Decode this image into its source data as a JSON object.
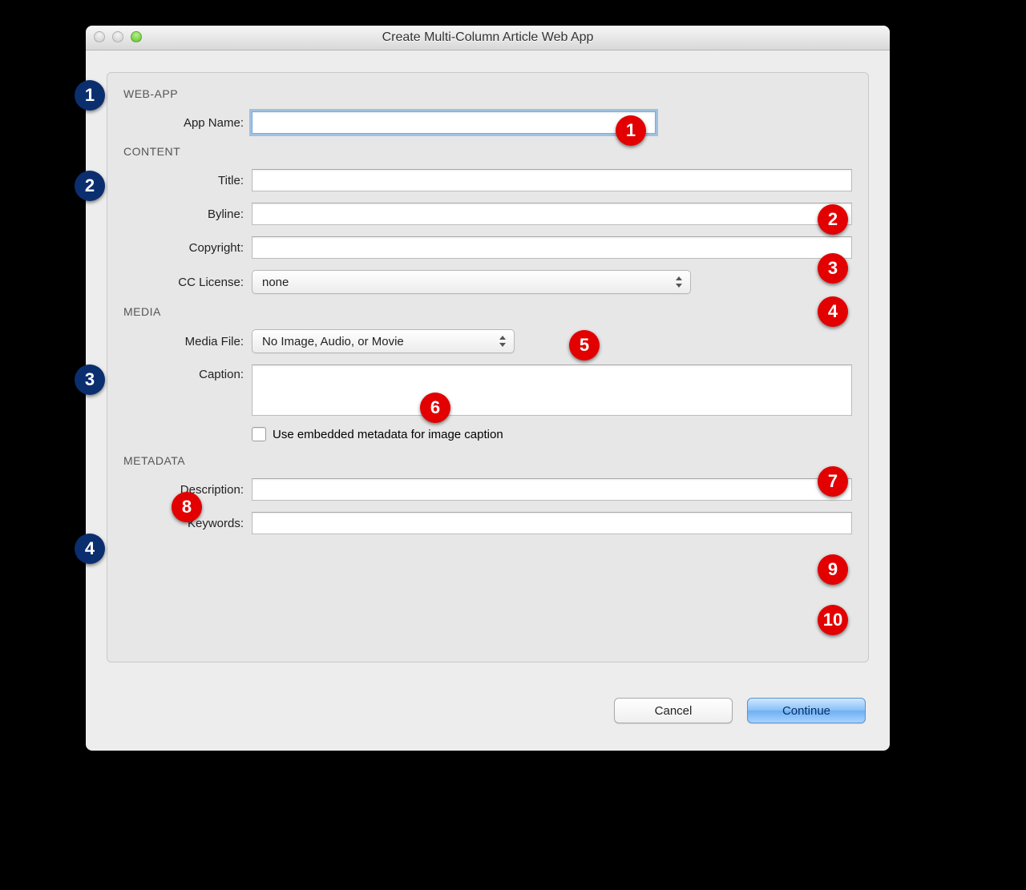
{
  "window": {
    "title": "Create Multi-Column Article Web App"
  },
  "sections": {
    "webapp": {
      "heading": "WEB-APP",
      "app_name_label": "App Name:",
      "app_name_value": ""
    },
    "content": {
      "heading": "CONTENT",
      "title_label": "Title:",
      "title_value": "",
      "byline_label": "Byline:",
      "byline_value": "",
      "copyright_label": "Copyright:",
      "copyright_value": "",
      "cc_label": "CC License:",
      "cc_value": "none"
    },
    "media": {
      "heading": "MEDIA",
      "file_label": "Media File:",
      "file_value": "No Image, Audio, or Movie",
      "caption_label": "Caption:",
      "caption_value": "",
      "use_embedded_label": "Use embedded metadata for image caption",
      "use_embedded_checked": false
    },
    "metadata": {
      "heading": "METADATA",
      "description_label": "Description:",
      "description_value": "",
      "keywords_label": "Keywords:",
      "keywords_value": ""
    }
  },
  "buttons": {
    "cancel": "Cancel",
    "continue": "Continue"
  },
  "annotations": {
    "blue": [
      "1",
      "2",
      "3",
      "4"
    ],
    "red": [
      "1",
      "2",
      "3",
      "4",
      "5",
      "6",
      "7",
      "8",
      "9",
      "10"
    ]
  }
}
